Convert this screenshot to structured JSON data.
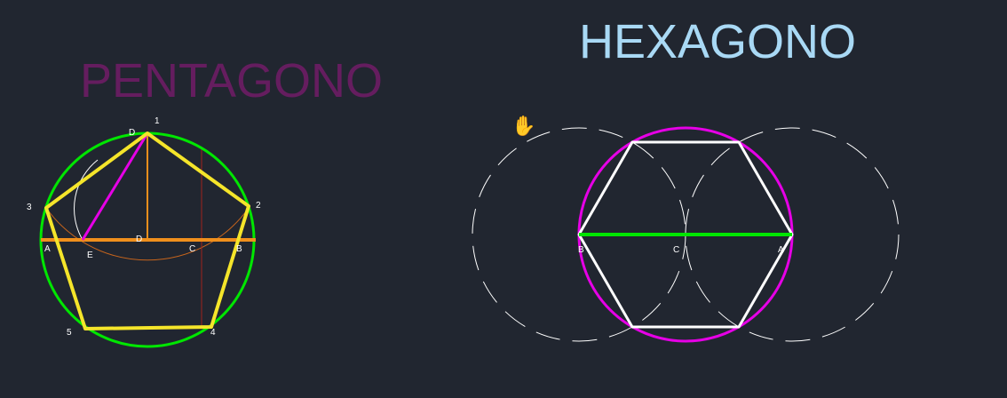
{
  "pentagon": {
    "title": "PENTAGONO",
    "vertex_labels": [
      "1",
      "2",
      "3",
      "4",
      "5"
    ],
    "point_labels": [
      "A",
      "B",
      "C",
      "D",
      "D",
      "E"
    ],
    "colors": {
      "title": "#651d5f",
      "circle": "#00e600",
      "polygon": "#f5e52a",
      "diameter": "#f08f1c",
      "radius": "#f08f1c",
      "side_segment": "#e600e6",
      "arc": "#c8651c",
      "guide_arc": "#ffffff",
      "guide_line": "#a0221c"
    }
  },
  "hexagon": {
    "title": "HEXAGONO",
    "point_labels": [
      "A",
      "B",
      "C"
    ],
    "colors": {
      "title": "#a9d9f5",
      "circle": "#e600e6",
      "polygon": "#ffffff",
      "diameter": "#00e600",
      "dashed_arcs": "#ffffff"
    }
  },
  "cursor": {
    "icon": "hand-pan-icon",
    "glyph": "✋"
  }
}
